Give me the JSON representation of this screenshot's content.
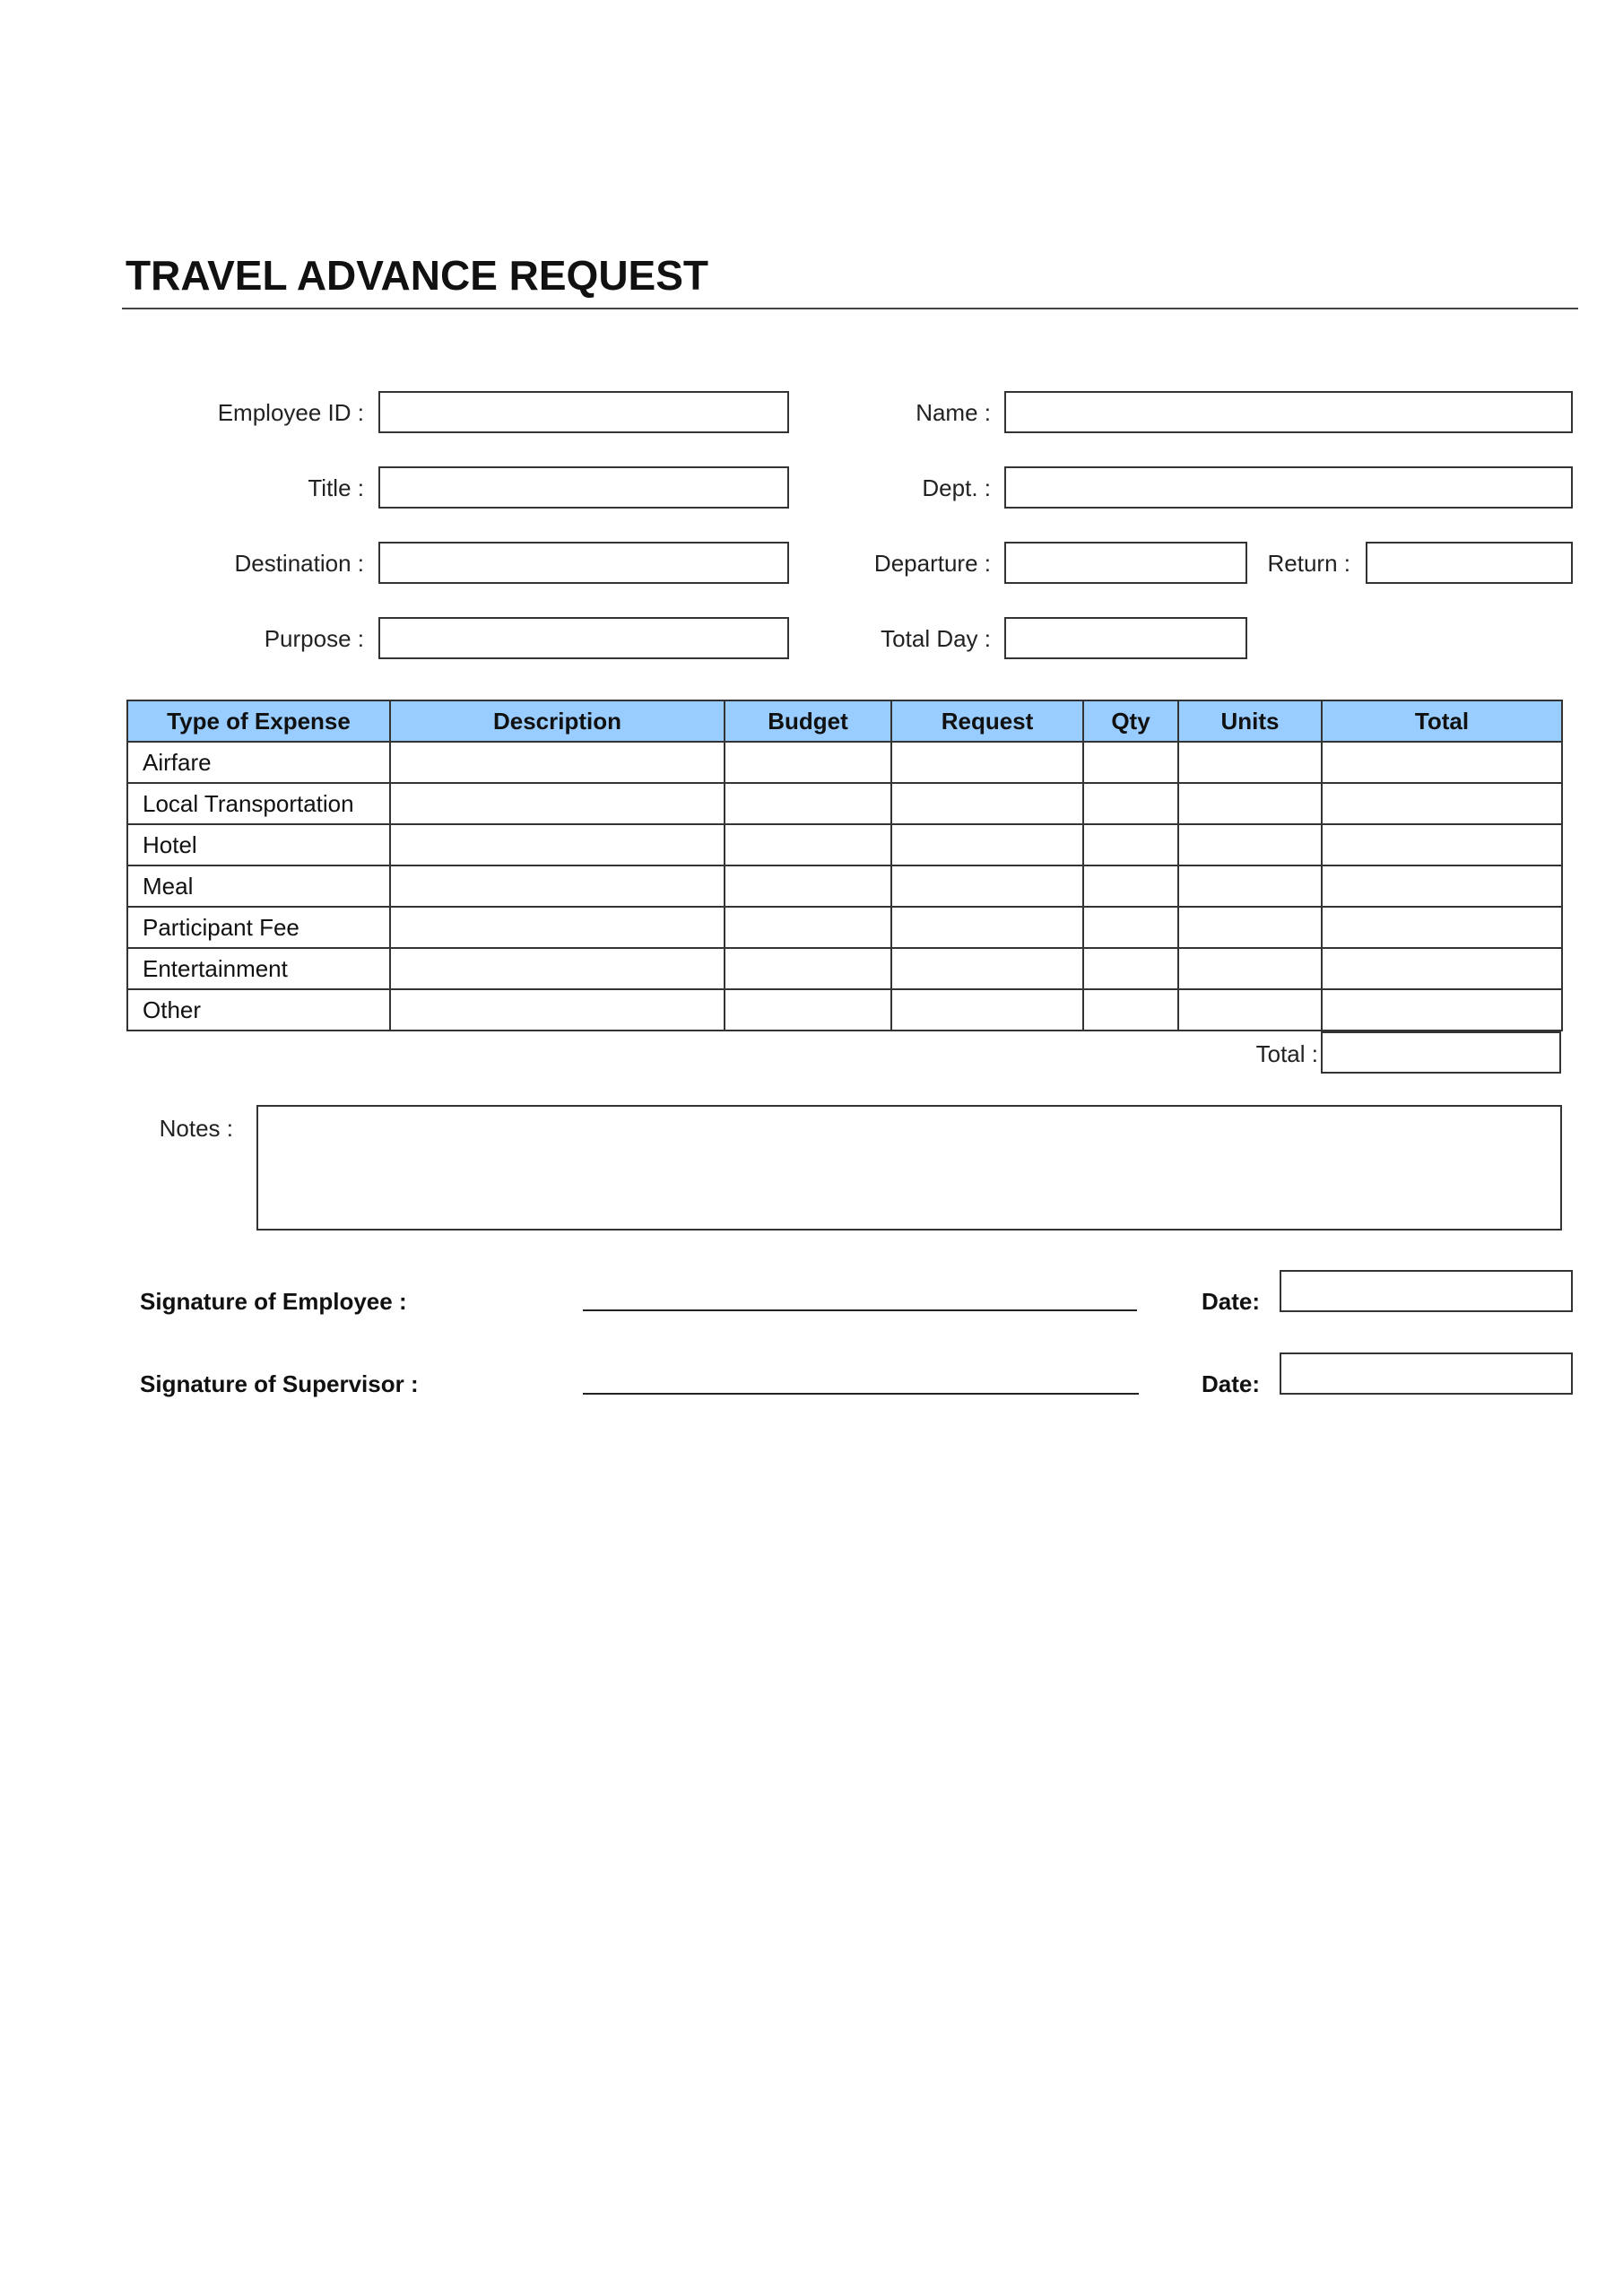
{
  "document": {
    "title": "TRAVEL ADVANCE REQUEST"
  },
  "fields": {
    "employee_id": {
      "label": "Employee ID :",
      "value": ""
    },
    "title": {
      "label": "Title :",
      "value": ""
    },
    "destination": {
      "label": "Destination :",
      "value": ""
    },
    "purpose": {
      "label": "Purpose :",
      "value": ""
    },
    "name": {
      "label": "Name :",
      "value": ""
    },
    "dept": {
      "label": "Dept. :",
      "value": ""
    },
    "departure": {
      "label": "Departure :",
      "value": ""
    },
    "return": {
      "label": "Return :",
      "value": ""
    },
    "total_day": {
      "label": "Total Day :",
      "value": ""
    }
  },
  "expense_table": {
    "headers": [
      "Type of Expense",
      "Description",
      "Budget",
      "Request",
      "Qty",
      "Units",
      "Total"
    ],
    "header_color": "#99ccff",
    "rows": [
      {
        "type": "Airfare",
        "description": "",
        "budget": "",
        "request": "",
        "qty": "",
        "units": "",
        "total": ""
      },
      {
        "type": "Local Transportation",
        "description": "",
        "budget": "",
        "request": "",
        "qty": "",
        "units": "",
        "total": ""
      },
      {
        "type": "Hotel",
        "description": "",
        "budget": "",
        "request": "",
        "qty": "",
        "units": "",
        "total": ""
      },
      {
        "type": "Meal",
        "description": "",
        "budget": "",
        "request": "",
        "qty": "",
        "units": "",
        "total": ""
      },
      {
        "type": "Participant Fee",
        "description": "",
        "budget": "",
        "request": "",
        "qty": "",
        "units": "",
        "total": ""
      },
      {
        "type": "Entertainment",
        "description": "",
        "budget": "",
        "request": "",
        "qty": "",
        "units": "",
        "total": ""
      },
      {
        "type": "Other",
        "description": "",
        "budget": "",
        "request": "",
        "qty": "",
        "units": "",
        "total": ""
      }
    ],
    "grand_total_label": "Total :",
    "grand_total_value": ""
  },
  "notes": {
    "label": "Notes :",
    "value": ""
  },
  "signatures": {
    "employee": {
      "label": "Signature of Employee :",
      "date_label": "Date:",
      "date_value": ""
    },
    "supervisor": {
      "label": "Signature of Supervisor :",
      "date_label": "Date:",
      "date_value": ""
    }
  }
}
